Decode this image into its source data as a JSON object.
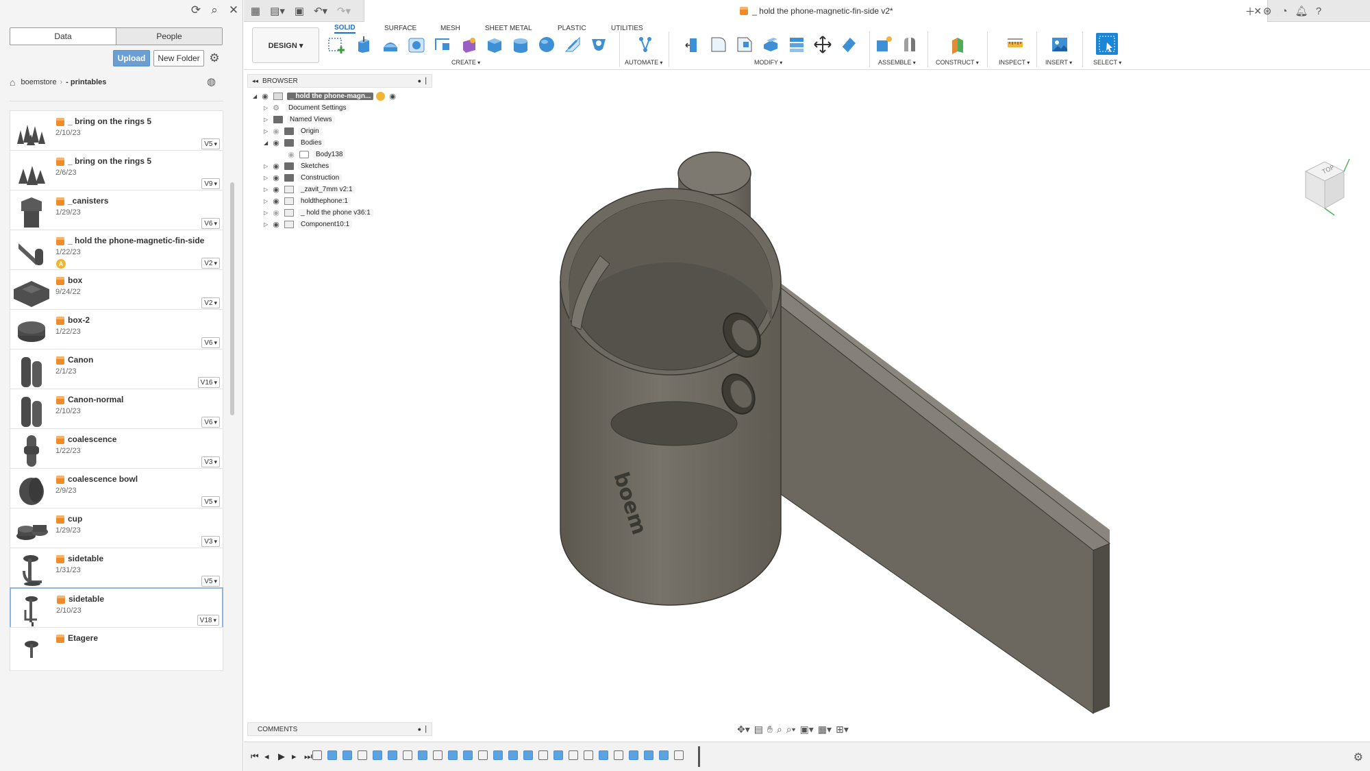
{
  "left_panel": {
    "tabs": [
      {
        "label": "Data"
      },
      {
        "label": "People"
      }
    ],
    "upload_label": "Upload",
    "new_folder_label": "New Folder",
    "breadcrumb": {
      "project": "boemstore",
      "folder": "- printables"
    },
    "files": [
      {
        "name": "_ bring on the rings 5",
        "date": "2/10/23",
        "version": "V5"
      },
      {
        "name": "_ bring on the rings 5",
        "date": "2/6/23",
        "version": "V9"
      },
      {
        "name": "_canisters",
        "date": "1/29/23",
        "version": "V6"
      },
      {
        "name": "_ hold the phone-magnetic-fin-side",
        "date": "1/22/23",
        "version": "V2"
      },
      {
        "name": "box",
        "date": "9/24/22",
        "version": "V2"
      },
      {
        "name": "box-2",
        "date": "1/22/23",
        "version": "V6"
      },
      {
        "name": "Canon",
        "date": "2/1/23",
        "version": "V16"
      },
      {
        "name": "Canon-normal",
        "date": "2/10/23",
        "version": "V6"
      },
      {
        "name": "coalescence",
        "date": "1/22/23",
        "version": "V3"
      },
      {
        "name": "coalescence bowl",
        "date": "2/9/23",
        "version": "V5"
      },
      {
        "name": "cup",
        "date": "1/29/23",
        "version": "V3"
      },
      {
        "name": "sidetable",
        "date": "1/31/23",
        "version": "V5"
      },
      {
        "name": "sidetable",
        "date": "2/10/23",
        "version": "V18"
      },
      {
        "name": "Etagere",
        "date": "",
        "version": ""
      }
    ]
  },
  "document": {
    "title": "_ hold the phone-magnetic-fin-side v2*"
  },
  "toolbar": {
    "design_label": "DESIGN ▾",
    "workspace_tabs": [
      "SOLID",
      "SURFACE",
      "MESH",
      "SHEET METAL",
      "PLASTIC",
      "UTILITIES"
    ],
    "groups": [
      "CREATE",
      "AUTOMATE",
      "MODIFY",
      "ASSEMBLE",
      "CONSTRUCT",
      "INSPECT",
      "INSERT",
      "SELECT"
    ]
  },
  "browser": {
    "title": "BROWSER",
    "root": "_ hold the phone-magn...",
    "items": [
      "Document Settings",
      "Named Views",
      "Origin",
      "Bodies",
      "Body138",
      "Sketches",
      "Construction",
      "_zavit_7mm v2:1",
      "holdthephone:1",
      "_ hold the phone v36:1",
      "Component10:1"
    ]
  },
  "comments_label": "COMMENTS",
  "model_text": "boem",
  "colors": {
    "accent": "#1c6fd1",
    "model": "#6e6a60",
    "upload": "#6a9fd4",
    "file_icon": "#ee8b2a"
  }
}
